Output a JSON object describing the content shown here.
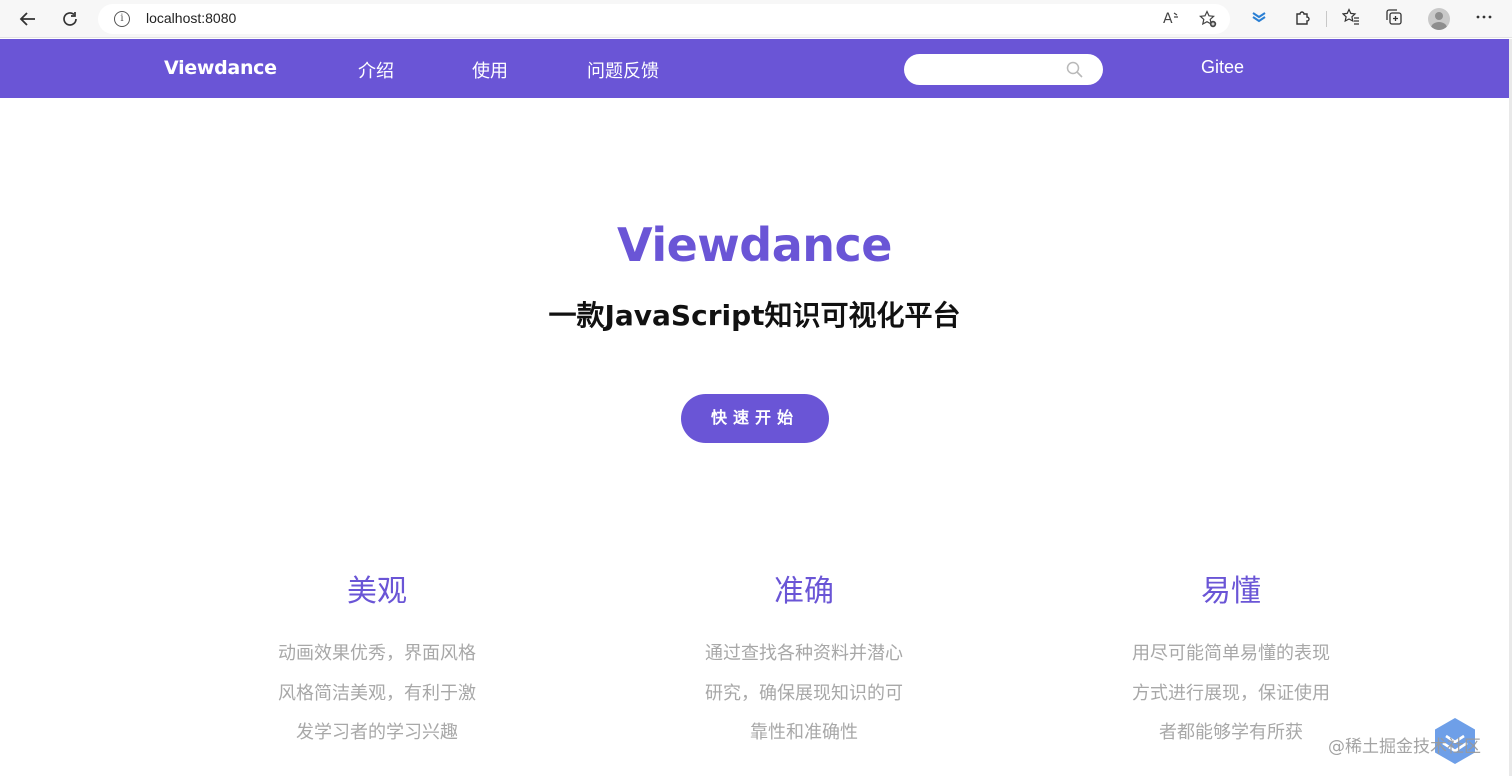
{
  "browser": {
    "url": "localhost:8080",
    "info_icon_char": "i"
  },
  "header": {
    "brand": "Viewdance",
    "nav": [
      "介绍",
      "使用",
      "问题反馈"
    ],
    "search_placeholder": "",
    "gitee": "Gitee"
  },
  "hero": {
    "title": "Viewdance",
    "subtitle": "一款JavaScript知识可视化平台",
    "cta": "快速开始"
  },
  "features": [
    {
      "title": "美观",
      "desc": [
        "动画效果优秀，界面风格",
        "风格简洁美观，有利于激",
        "发学习者的学习兴趣"
      ]
    },
    {
      "title": "准确",
      "desc": [
        "通过查找各种资料并潜心",
        "研究，确保展现知识的可",
        "靠性和准确性"
      ]
    },
    {
      "title": "易懂",
      "desc": [
        "用尽可能简单易懂的表现",
        "方式进行展现，保证使用",
        "者都能够学有所获"
      ]
    }
  ],
  "watermark": "@稀土掘金技术社区",
  "colors": {
    "accent": "#6a55d6",
    "muted_text": "#a8a8a8"
  }
}
